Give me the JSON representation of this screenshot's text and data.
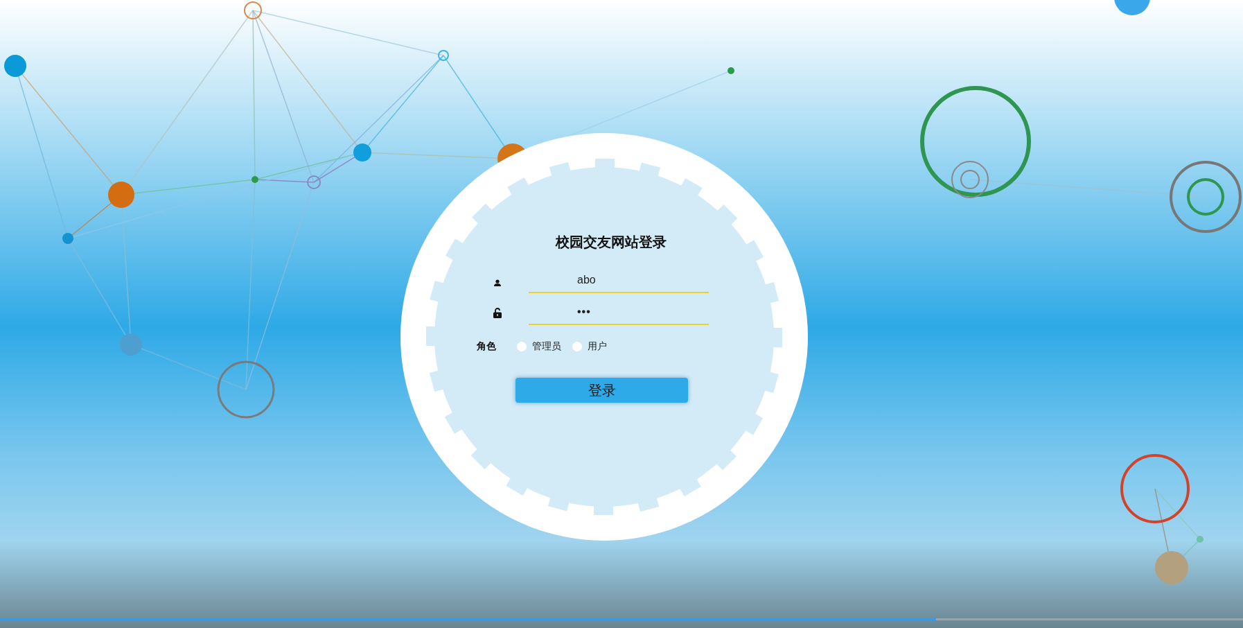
{
  "title": "校园交友网站登录",
  "username": {
    "value": "abo"
  },
  "password": {
    "value": "•••"
  },
  "role": {
    "label": "角色",
    "options": [
      {
        "label": "管理员",
        "selected": false
      },
      {
        "label": "用户",
        "selected": false
      }
    ]
  },
  "submit": "登录",
  "progress": {
    "level": 0.753
  }
}
